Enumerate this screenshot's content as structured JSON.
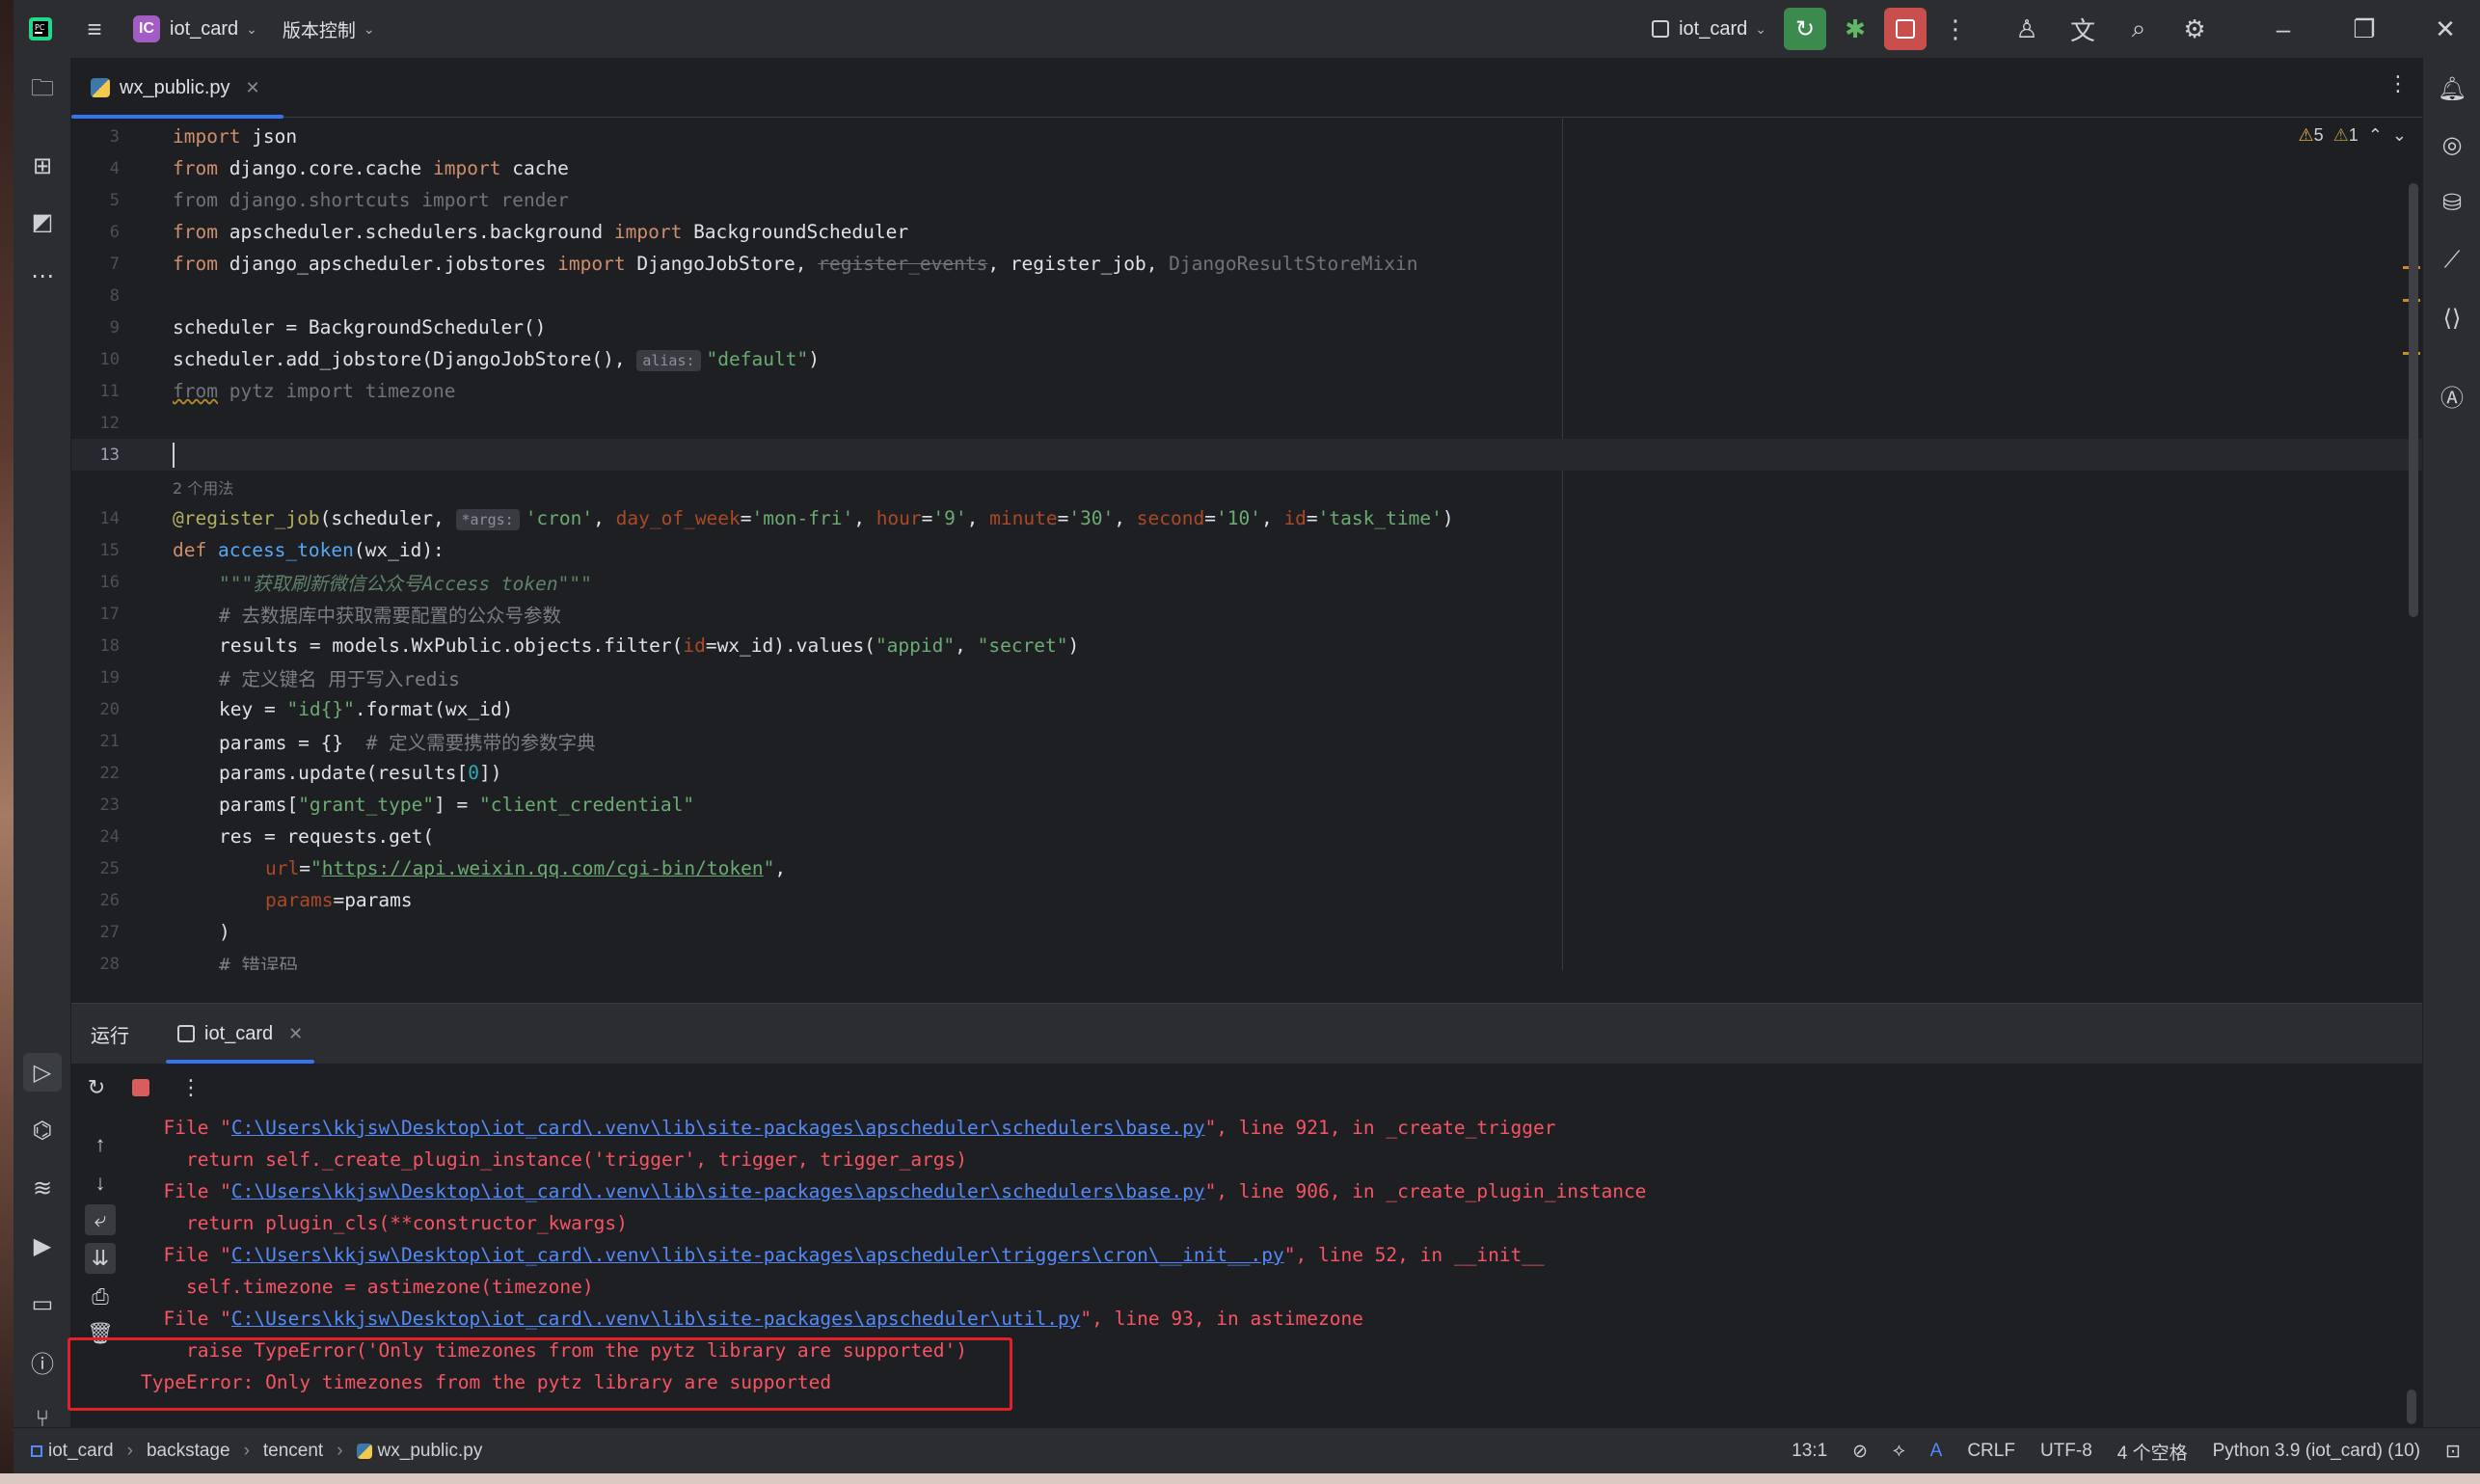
{
  "titlebar": {
    "project_badge": "IC",
    "project_name": "iot_card",
    "vcs_menu": "版本控制",
    "run_config": "iot_card"
  },
  "editor": {
    "tab_label": "wx_public.py",
    "inspection": {
      "warnings": "5",
      "weak_warnings": "1"
    },
    "usages_hint": "2 个用法",
    "hints": {
      "alias": "alias:",
      "args": "*args:"
    },
    "lines": {
      "l3": "3",
      "l4": "4",
      "l5": "5",
      "l6": "6",
      "l7": "7",
      "l8": "8",
      "l9": "9",
      "l10": "10",
      "l11": "11",
      "l12": "12",
      "l13": "13",
      "l14": "14",
      "l15": "15",
      "l16": "16",
      "l17": "17",
      "l18": "18",
      "l19": "19",
      "l20": "20",
      "l21": "21",
      "l22": "22",
      "l23": "23",
      "l24": "24",
      "l25": "25",
      "l26": "26",
      "l27": "27",
      "l28": "28"
    },
    "code": {
      "docstring": "\"\"\"获取刷新微信公众号Access token\"\"\"",
      "comment17": "# 去数据库中获取需要配置的公众号参数",
      "comment19": "# 定义键名 用于写入redis",
      "comment21": "# 定义需要携带的参数字典",
      "comment28": "# 错误码",
      "url": "https://api.weixin.qq.com/cgi-bin/token"
    }
  },
  "run_panel": {
    "title": "运行",
    "tab_label": "iot_card",
    "console": {
      "path1": "C:\\Users\\kkjsw\\Desktop\\iot_card\\.venv\\lib\\site-packages\\apscheduler\\schedulers\\base.py",
      "rest1": "\", line 921, in _create_trigger",
      "code1": "    return self._create_plugin_instance('trigger', trigger, trigger_args)",
      "path2": "C:\\Users\\kkjsw\\Desktop\\iot_card\\.venv\\lib\\site-packages\\apscheduler\\schedulers\\base.py",
      "rest2": "\", line 906, in _create_plugin_instance",
      "code2": "    return plugin_cls(**constructor_kwargs)",
      "path3": "C:\\Users\\kkjsw\\Desktop\\iot_card\\.venv\\lib\\site-packages\\apscheduler\\triggers\\cron\\__init__.py",
      "rest3": "\", line 52, in __init__",
      "code3": "    self.timezone = astimezone(timezone)",
      "path4": "C:\\Users\\kkjsw\\Desktop\\iot_card\\.venv\\lib\\site-packages\\apscheduler\\util.py",
      "rest4": "\", line 93, in astimezone",
      "raise_line": "    raise TypeError('Only timezones from the pytz library are supported')",
      "error_line": "TypeError: Only timezones from the pytz library are supported",
      "file_prefix": "  File \""
    }
  },
  "statusbar": {
    "breadcrumb": [
      "iot_card",
      "backstage",
      "tencent",
      "wx_public.py"
    ],
    "position": "13:1",
    "line_sep": "CRLF",
    "encoding": "UTF-8",
    "indent": "4 个空格",
    "interpreter": "Python 3.9 (iot_card) (10)"
  },
  "colors": {
    "error_box": "#e3202a",
    "accent": "#3574f0",
    "error_text": "#f75464"
  }
}
